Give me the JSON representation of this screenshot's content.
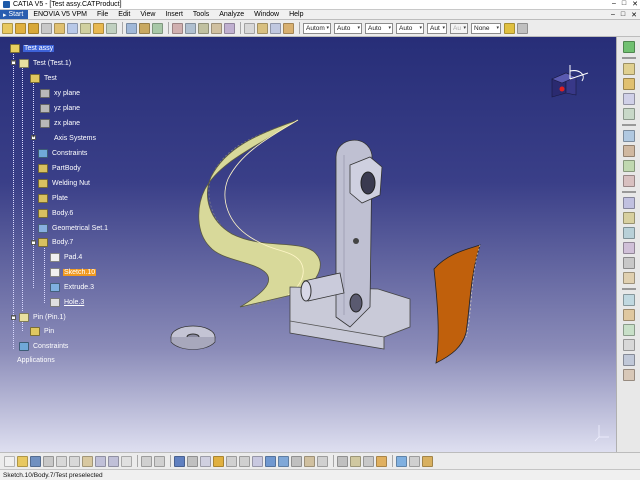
{
  "window": {
    "title": "CATIA V5 - [Test assy.CATProduct]",
    "buttons": [
      "–",
      "□",
      "✕"
    ]
  },
  "menubar": {
    "start_label": "Start",
    "items": [
      "ENOVIA V5 VPM",
      "File",
      "Edit",
      "View",
      "Insert",
      "Tools",
      "Analyze",
      "Window",
      "Help"
    ]
  },
  "toolbar_top": {
    "combos": [
      "Autom",
      "Auto",
      "Auto",
      "Auto",
      "Aut",
      "Au",
      "None"
    ]
  },
  "tree": {
    "nodes": [
      {
        "label": "Test assy",
        "state": "selected"
      },
      {
        "label": "Test (Test.1)"
      },
      {
        "label": "Test"
      },
      {
        "label": "xy plane"
      },
      {
        "label": "yz plane"
      },
      {
        "label": "zx plane"
      },
      {
        "label": "Axis Systems"
      },
      {
        "label": "Constraints"
      },
      {
        "label": "PartBody"
      },
      {
        "label": "Welding Nut"
      },
      {
        "label": "Plate"
      },
      {
        "label": "Body.6"
      },
      {
        "label": "Geometrical Set.1"
      },
      {
        "label": "Body.7"
      },
      {
        "label": "Pad.4"
      },
      {
        "label": "Sketch.10",
        "state": "preselected"
      },
      {
        "label": "Extrude.3"
      },
      {
        "label": "Hole.3",
        "state": "underlined"
      },
      {
        "label": "Pin (Pin.1)"
      },
      {
        "label": "Pin"
      },
      {
        "label": "Constraints"
      },
      {
        "label": "Applications"
      }
    ]
  },
  "status": {
    "text": "Sketch.10/Body.7/Test preselected"
  },
  "colors": {
    "viewport_top": "#272e78",
    "viewport_bottom": "#dedff0",
    "selection": "#3d62d8",
    "preselection": "#f09a20",
    "surface_yellow": "#d8d99a",
    "surface_orange": "#c0600c",
    "part_grey": "#c9cad8"
  }
}
